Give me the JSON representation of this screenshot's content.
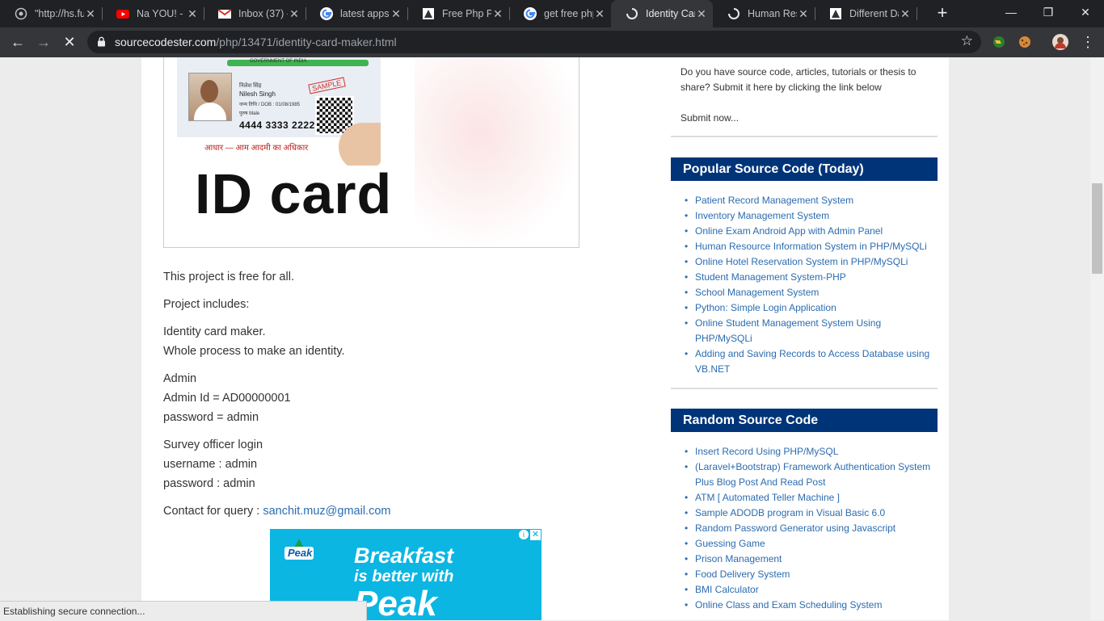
{
  "browser": {
    "tabs": [
      {
        "title": "\"http://hs.fu",
        "icon": "globe-icon"
      },
      {
        "title": "Na YOU! - L",
        "icon": "youtube-icon"
      },
      {
        "title": "Inbox (37) -",
        "icon": "gmail-icon"
      },
      {
        "title": "latest apps",
        "icon": "google-icon"
      },
      {
        "title": "Free Php Pr",
        "icon": "site-icon"
      },
      {
        "title": "get free php",
        "icon": "google-icon"
      },
      {
        "title": "Identity Car",
        "icon": "loading-icon",
        "active": true
      },
      {
        "title": "Human Res",
        "icon": "loading-icon"
      },
      {
        "title": "Different Da",
        "icon": "site-icon"
      }
    ],
    "url_domain": "sourcecodester.com",
    "url_path": "/php/13471/identity-card-maker.html"
  },
  "idcard": {
    "gov_text": "GOVERNMENT OF INDIA",
    "name_hindi": "निलेश सिंह",
    "name": "Nilesh Singh",
    "dob": "जन्म तिथि / DOB : 01/08/1985",
    "sex": "पुरुष   Male",
    "sample": "SAMPLE",
    "number": "4444 3333 2222",
    "slogan": "आधार — आम आदमी का अधिकार",
    "caption": "ID card"
  },
  "article": {
    "free": "This project is free for all.",
    "includes_title": "Project includes:",
    "include_1": "Identity card maker.",
    "include_2": "Whole process to make an identity.",
    "admin_title": "Admin",
    "admin_id": "Admin Id = AD00000001",
    "admin_pw": "password = admin",
    "survey_title": "Survey officer login",
    "survey_user": "username : admin",
    "survey_pw": "password : admin",
    "contact_label": "Contact for query :",
    "contact_email": "sanchit.muz@gmail.com"
  },
  "ad": {
    "brand": "Peak",
    "line1": "Breakfast",
    "line2": "is better with",
    "line3": "Peak"
  },
  "sidebar": {
    "submit_text_1": "Do you have source code, articles, tutorials or thesis to",
    "submit_text_2": "share? Submit it here by clicking the link below",
    "submit_link": "Submit now...",
    "popular_title": "Popular Source Code (Today)",
    "popular": [
      "Patient Record Management System",
      "Inventory Management System",
      "Online Exam Android App with Admin Panel",
      "Human Resource Information System in PHP/MySQLi",
      "Online Hotel Reservation System in PHP/MySQLi",
      "Student Management System-PHP",
      "School Management System",
      "Python: Simple Login Application",
      "Online Student Management System Using PHP/MySQLi",
      "Adding and Saving Records to Access Database using VB.NET"
    ],
    "random_title": "Random Source Code",
    "random": [
      "Insert Record Using PHP/MySQL",
      "(Laravel+Bootstrap) Framework Authentication System Plus Blog Post And Read Post",
      "ATM [ Automated Teller Machine ]",
      "Sample ADODB program in Visual Basic 6.0",
      "Random Password Generator using Javascript",
      "Guessing Game",
      "Prison Management",
      "Food Delivery System",
      "BMI Calculator",
      "Online Class and Exam Scheduling System"
    ]
  },
  "status": "Establishing secure connection..."
}
